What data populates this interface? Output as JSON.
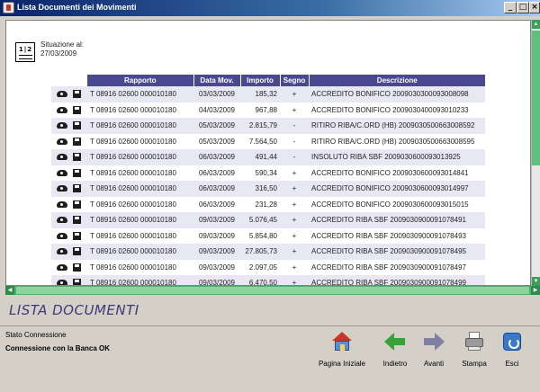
{
  "window": {
    "title": "Lista Documenti dei Movimenti",
    "buttons": {
      "minimize": "_",
      "maximize": "□",
      "close": "×"
    }
  },
  "header": {
    "calendar_text": "1|2",
    "situation_label": "Situazione al:",
    "situation_date": "27/03/2009"
  },
  "table": {
    "columns": [
      "Rapporto",
      "Data Mov.",
      "Importo",
      "Segno",
      "Descrizione"
    ],
    "rows": [
      [
        "T 08916 02600 000010180",
        "03/03/2009",
        "185,32",
        "+",
        "ACCREDITO BONIFICO 2009030300093008098"
      ],
      [
        "T 08916 02600 000010180",
        "04/03/2009",
        "967,88",
        "+",
        "ACCREDITO BONIFICO 2009030400093010233"
      ],
      [
        "T 08916 02600 000010180",
        "05/03/2009",
        "2.815,79",
        "-",
        "RITIRO RIBA/C.ORD (HB) 2009030500663008592"
      ],
      [
        "T 08916 02600 000010180",
        "05/03/2009",
        "7.564,50",
        "-",
        "RITIRO RIBA/C.ORD (HB) 2009030500663008595"
      ],
      [
        "T 08916 02600 000010180",
        "06/03/2009",
        "491,44",
        "-",
        "INSOLUTO RIBA SBF 2009030600093013925"
      ],
      [
        "T 08916 02600 000010180",
        "06/03/2009",
        "590,34",
        "+",
        "ACCREDITO BONIFICO 2009030600093014841"
      ],
      [
        "T 08916 02600 000010180",
        "06/03/2009",
        "316,50",
        "+",
        "ACCREDITO BONIFICO 2009030600093014997"
      ],
      [
        "T 08916 02600 000010180",
        "06/03/2009",
        "231,28",
        "+",
        "ACCREDITO BONIFICO 2009030600093015015"
      ],
      [
        "T 08916 02600 000010180",
        "09/03/2009",
        "5.076,45",
        "+",
        "ACCREDITO RIBA SBF 2009030900091078491"
      ],
      [
        "T 08916 02600 000010180",
        "09/03/2009",
        "5.854,80",
        "+",
        "ACCREDITO RIBA SBF 2009030900091078493"
      ],
      [
        "T 08916 02600 000010180",
        "09/03/2009",
        "27.805,73",
        "+",
        "ACCREDITO RIBA SBF 2009030900091078495"
      ],
      [
        "T 08916 02600 000010180",
        "09/03/2009",
        "2.097,05",
        "+",
        "ACCREDITO RIBA SBF 2009030900091078497"
      ],
      [
        "T 08916 02600 000010180",
        "09/03/2009",
        "6.470,50",
        "+",
        "ACCREDITO RIBA SBF 2009030900091078499"
      ]
    ]
  },
  "section": {
    "title": "LISTA DOCUMENTI"
  },
  "status": {
    "label": "Stato Connessione",
    "value": "Connessione con la Banca OK"
  },
  "toolbar": {
    "home": "Pagina Iniziale",
    "back": "Indietro",
    "forward": "Avanti",
    "print": "Stampa",
    "exit": "Esci"
  },
  "scrollbars": {
    "up": "▲",
    "down": "▼",
    "left": "◀",
    "right": "▶"
  }
}
